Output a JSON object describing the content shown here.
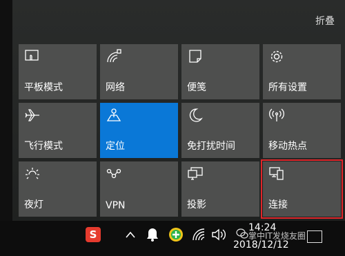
{
  "action_center": {
    "collapse_label": "折叠",
    "tiles": [
      {
        "label": "平板模式",
        "icon": "tablet-mode-icon",
        "active": false
      },
      {
        "label": "网络",
        "icon": "network-icon",
        "active": false
      },
      {
        "label": "便笺",
        "icon": "note-icon",
        "active": false
      },
      {
        "label": "所有设置",
        "icon": "gear-icon",
        "active": false
      },
      {
        "label": "飞行模式",
        "icon": "airplane-icon",
        "active": false
      },
      {
        "label": "定位",
        "icon": "location-icon",
        "active": true
      },
      {
        "label": "免打扰时间",
        "icon": "moon-icon",
        "active": false
      },
      {
        "label": "移动热点",
        "icon": "hotspot-icon",
        "active": false
      },
      {
        "label": "夜灯",
        "icon": "brightness-icon",
        "active": false
      },
      {
        "label": "VPN",
        "icon": "vpn-icon",
        "active": false
      },
      {
        "label": "投影",
        "icon": "project-icon",
        "active": false
      },
      {
        "label": "连接",
        "icon": "connect-icon",
        "active": false,
        "highlighted": true
      }
    ],
    "accent_color": "#0a78d7",
    "highlight_color": "#e0262a"
  },
  "taskbar": {
    "sogou_label": "S",
    "time": "14:24",
    "date": "2018/12/12",
    "watermark": "掌中IT发烧友圈"
  }
}
